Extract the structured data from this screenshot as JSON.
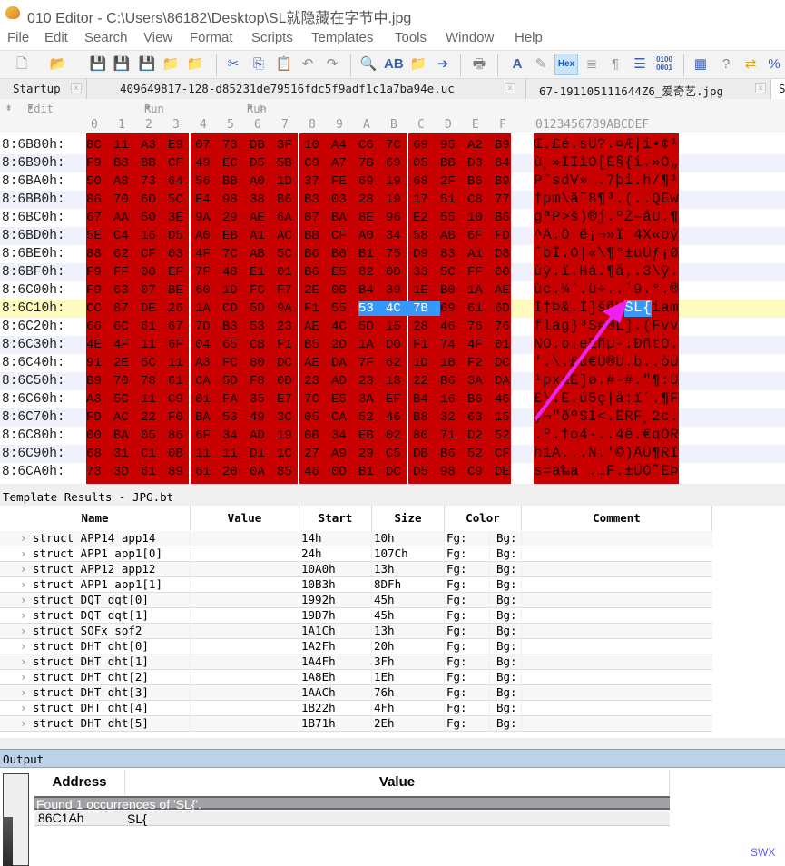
{
  "window": {
    "title": "010 Editor - C:\\Users\\86182\\Desktop\\SL就隐藏在字节中.jpg"
  },
  "menu": [
    "File",
    "Edit",
    "Search",
    "View",
    "Format",
    "Scripts",
    "Templates",
    "Tools",
    "Window",
    "Help"
  ],
  "toolbar": {
    "hex_label": "Hex",
    "icons": [
      "new-file-icon",
      "open-icon",
      "save-icon",
      "save-as-icon",
      "save-all-icon",
      "open-folder-icon",
      "folder-icon",
      "cut-icon",
      "copy-icon",
      "paste-icon",
      "undo-icon",
      "redo-icon",
      "find-icon",
      "replace-icon",
      "find-in-files-icon",
      "goto-icon",
      "print-icon",
      "font-icon",
      "highlight-icon",
      "hex-icon",
      "columns-icon",
      "pilcrow-icon",
      "list-icon",
      "binary-icon",
      "calculator-icon",
      "help-icon",
      "compare-icon",
      "percent-icon"
    ]
  },
  "tabs": [
    {
      "label": "Startup"
    },
    {
      "label": "409649817-128-d85231de79516fdc5f9adf1c1a7ba94e.uc"
    },
    {
      "label": "67-191105111644Z6_爱奇艺.jpg"
    },
    {
      "label": "S"
    }
  ],
  "editbar": {
    "edit_as": "Edit As: Hex",
    "run_script": "Run Script",
    "run_template": "Run Template: JPG.bt"
  },
  "columns": {
    "hex": [
      "0",
      "1",
      "2",
      "3",
      "4",
      "5",
      "6",
      "7",
      "8",
      "9",
      "A",
      "B",
      "C",
      "D",
      "E",
      "F"
    ],
    "ascii": "0123456789ABCDEF"
  },
  "hex_rows": [
    {
      "addr": "8:6B80h:",
      "bytes": "8C 11 A3 E9 07 73 DB 3F 10 A4 C6 7C 69 95 A2 B9",
      "ascii": "Œ.£é.sÛ?.¤Æ|i•¢¹"
    },
    {
      "addr": "8:6B90h:",
      "bytes": "F9 B8 BB CF 49 EC D5 5B C9 A7 7B 69 05 BB D3 84",
      "ascii": "ù¸»ÏIìÕ[É§{i.»Ó„"
    },
    {
      "addr": "8:6BA0h:",
      "bytes": "50 A8 73 64 56 BB A0 1D 37 FE 69 19 68 2F B6 B9",
      "ascii": "P¨sdV» .7þi.h/¶¹"
    },
    {
      "addr": "8:6BB0h:",
      "bytes": "86 70 6D 5C E4 98 38 B6 B3 03 28 19 17 51 C8 77",
      "ascii": "†pm\\ä˜8¶³.(..QÈw"
    },
    {
      "addr": "8:6BC0h:",
      "bytes": "67 AA 50 3E 9A 29 AE 6A 07 BA 8E 96 E2 55 10 B6",
      "ascii": "gªP>š)®j.ºŽ–âU.¶"
    },
    {
      "addr": "8:6BD0h:",
      "bytes": "5E C4 16 D5 A0 EB A1 AC BB CF A0 34 58 AB 6F FD",
      "ascii": "^Ä.Õ ë¡¬»Ï 4X«oý"
    },
    {
      "addr": "8:6BE0h:",
      "bytes": "88 62 CF 03 4F 7C AB 5C B6 B0 B1 75 D9 83 A1 D8",
      "ascii": "ˆbÏ.O|«\\¶°±uÙƒ¡Ø"
    },
    {
      "addr": "8:6BF0h:",
      "bytes": "F9 FF 00 EF 7F 48 E1 01 B6 E5 82 0D 33 5C FF 00",
      "ascii": "ùÿ.ï.Há.¶å‚.3\\ÿ."
    },
    {
      "addr": "8:6C00h:",
      "bytes": "F9 63 07 BE 60 1D FC F7 2E 0B B4 39 1E B0 1A AE",
      "ascii": "ùc.¾`.ü÷..´9.°.®"
    },
    {
      "addr": "8:6C10h:",
      "bytes": "CC 87 DE 26 1A CD 5D 9A F1 55 53 4C 7B 69 61 6D",
      "ascii": "Ì‡Þ&.Í]šñUSL{iam"
    },
    {
      "addr": "8:6C20h:",
      "bytes": "66 6C 61 67 7D B3 53 23 AE 4C 5D 15 28 46 76 76",
      "ascii": "flag}³S#®L].(Fvv"
    },
    {
      "addr": "8:6C30h:",
      "bytes": "4E 4F 11 6F 04 65 CB F1 B5 2D 1A D0 F1 74 4F 01",
      "ascii": "NO.o.eËñµ-.ÐñtO."
    },
    {
      "addr": "8:6C40h:",
      "bytes": "91 2E 5C 11 A3 FC 80 DC AE DA 7F 62 1D 1B F2 DC",
      "ascii": "'.\\.£ü€Ü®Ú.b..òÜ"
    },
    {
      "addr": "8:6C50h:",
      "bytes": "B9 70 78 61 CA 5D F8 0D 23 AD 23 18 22 B6 3A DA",
      "ascii": "¹pxaÊ]ø.#-#.\"¶:Ú"
    },
    {
      "addr": "8:6C60h:",
      "bytes": "A3 5C 11 C9 01 FA 35 E7 7C E5 3A EF B4 16 B6 46",
      "ascii": "£\\.É.ú5ç|å:ï´.¶F"
    },
    {
      "addr": "8:6C70h:",
      "bytes": "FD AC 22 F0 BA 53 49 3C 05 CA 52 46 B8 32 63 15",
      "ascii": "ý¬\"ðºSI<.ÊRF¸2c."
    },
    {
      "addr": "8:6C80h:",
      "bytes": "00 BA 05 86 6F 34 AD 19 0B 34 EB 02 80 71 D2 52",
      "ascii": ".º.†o4-..4ë.€qÒR"
    },
    {
      "addr": "8:6C90h:",
      "bytes": "68 31 C1 0B 11 11 D1 1C 27 A9 29 C5 DB B6 52 CF",
      "ascii": "h1Á...Ñ.'©)ÅÛ¶RÏ"
    },
    {
      "addr": "8:6CA0h:",
      "bytes": "73 3D 61 89 61 20 0A 85 46 0D B1 DC D5 98 C9 DE",
      "ascii": "s=a‰a .…F.±ÜÕ˜ÉÞ"
    }
  ],
  "cursor_row": "8:6C10h:",
  "selection": {
    "row": "8:6C10h:",
    "first_byte": 10,
    "last_byte": 12
  },
  "colors": {
    "highlight_bg": "#c80000",
    "selection": "#3399ff",
    "current_line": "#fffbbf",
    "arrow": "#ee22ee"
  },
  "template": {
    "title": "Template Results - JPG.bt",
    "headers": [
      "Name",
      "Value",
      "Start",
      "Size",
      "Color",
      "Comment"
    ],
    "rows": [
      {
        "name": "struct APP14 app14",
        "start": "14h",
        "size": "10h",
        "fg": "Fg:",
        "bg": "Bg:"
      },
      {
        "name": "struct APP1 app1[0]",
        "start": "24h",
        "size": "107Ch",
        "fg": "Fg:",
        "bg": "Bg:"
      },
      {
        "name": "struct APP12 app12",
        "start": "10A0h",
        "size": "13h",
        "fg": "Fg:",
        "bg": "Bg:"
      },
      {
        "name": "struct APP1 app1[1]",
        "start": "10B3h",
        "size": "8DFh",
        "fg": "Fg:",
        "bg": "Bg:"
      },
      {
        "name": "struct DQT dqt[0]",
        "start": "1992h",
        "size": "45h",
        "fg": "Fg:",
        "bg": "Bg:"
      },
      {
        "name": "struct DQT dqt[1]",
        "start": "19D7h",
        "size": "45h",
        "fg": "Fg:",
        "bg": "Bg:"
      },
      {
        "name": "struct SOFx sof2",
        "start": "1A1Ch",
        "size": "13h",
        "fg": "Fg:",
        "bg": "Bg:"
      },
      {
        "name": "struct DHT dht[0]",
        "start": "1A2Fh",
        "size": "20h",
        "fg": "Fg:",
        "bg": "Bg:"
      },
      {
        "name": "struct DHT dht[1]",
        "start": "1A4Fh",
        "size": "3Fh",
        "fg": "Fg:",
        "bg": "Bg:"
      },
      {
        "name": "struct DHT dht[2]",
        "start": "1A8Eh",
        "size": "1Eh",
        "fg": "Fg:",
        "bg": "Bg:"
      },
      {
        "name": "struct DHT dht[3]",
        "start": "1AACh",
        "size": "76h",
        "fg": "Fg:",
        "bg": "Bg:"
      },
      {
        "name": "struct DHT dht[4]",
        "start": "1B22h",
        "size": "4Fh",
        "fg": "Fg:",
        "bg": "Bg:"
      },
      {
        "name": "struct DHT dht[5]",
        "start": "1B71h",
        "size": "2Eh",
        "fg": "Fg:",
        "bg": "Bg:"
      }
    ]
  },
  "output": {
    "title": "Output",
    "headers": [
      "Address",
      "Value"
    ],
    "found": "Found 1 occurrences of 'SL{'.",
    "results": [
      {
        "address": "86C1Ah",
        "value": "SL{"
      }
    ]
  },
  "watermark": "SWX"
}
